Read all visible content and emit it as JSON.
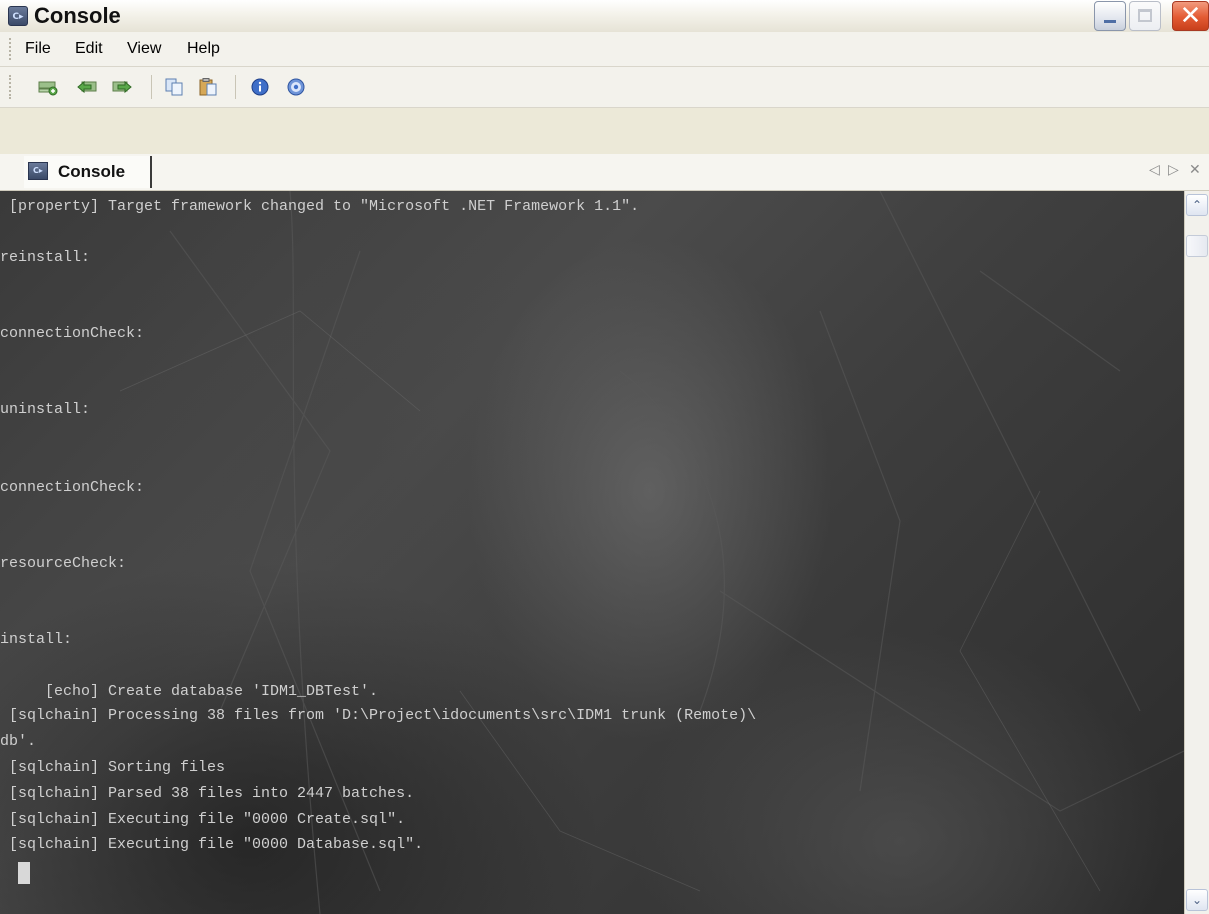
{
  "window": {
    "title": "Console",
    "app_icon_glyph": "C▸",
    "controls": {
      "minimize_icon": "minimize-icon",
      "maximize_icon": "maximize-icon",
      "close_icon": "close-icon",
      "close_glyph": "✕"
    }
  },
  "menu": {
    "items": [
      {
        "label": "File"
      },
      {
        "label": "Edit"
      },
      {
        "label": "View"
      },
      {
        "label": "Help"
      }
    ]
  },
  "toolbar": {
    "buttons": [
      {
        "icon": "new-console-icon"
      },
      {
        "icon": "back-icon"
      },
      {
        "icon": "forward-icon"
      },
      {
        "icon": "copy-icon"
      },
      {
        "icon": "paste-icon"
      },
      {
        "icon": "info-icon"
      },
      {
        "icon": "help-icon"
      }
    ]
  },
  "tabs": {
    "active": {
      "label": "Console",
      "icon_glyph": "C▸"
    },
    "controls": {
      "left": "◁",
      "right": "▷",
      "close": "✕"
    }
  },
  "console": {
    "lines": [
      " [property] Target framework changed to \"Microsoft .NET Framework 1.1\".",
      "reinstall:",
      "connectionCheck:",
      "uninstall:",
      "connectionCheck:",
      "resourceCheck:",
      "install:",
      "     [echo] Create database 'IDM1_DBTest'.",
      " [sqlchain] Processing 38 files from 'D:\\Project\\idocuments\\src\\IDM1 trunk (Remote)\\",
      "db'.",
      " [sqlchain] Sorting files",
      " [sqlchain] Parsed 38 files into 2447 batches.",
      " [sqlchain] Executing file \"0000 Create.sql\".",
      " [sqlchain] Executing file \"0000 Database.sql\"."
    ]
  },
  "scrollbar": {
    "up_glyph": "⌃",
    "down_glyph": "⌄"
  },
  "colors": {
    "console_text": "#cfcfcf",
    "close_button": "#e35a33",
    "minimize_accent": "#4f6fa5"
  }
}
